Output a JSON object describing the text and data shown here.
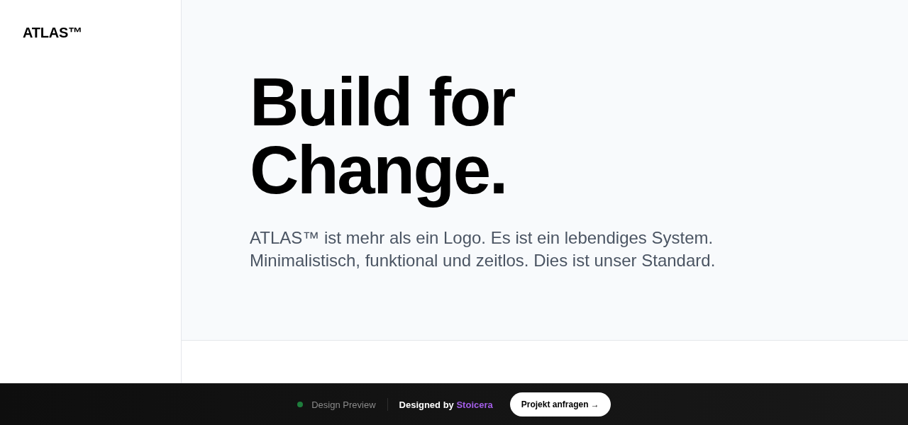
{
  "sidebar": {
    "logo": "ATLAS™"
  },
  "hero": {
    "headline": "Build for Change.",
    "lead": "ATLAS™ ist mehr als ein Logo. Es ist ein lebendiges System. Minimalistisch, funktional und zeitlos. Dies ist unser Standard."
  },
  "footer_bar": {
    "status_label": "Design Preview",
    "credit": {
      "prefix": "Designed by",
      "link": "Stoicera"
    },
    "cta": "Projekt anfragen →"
  }
}
